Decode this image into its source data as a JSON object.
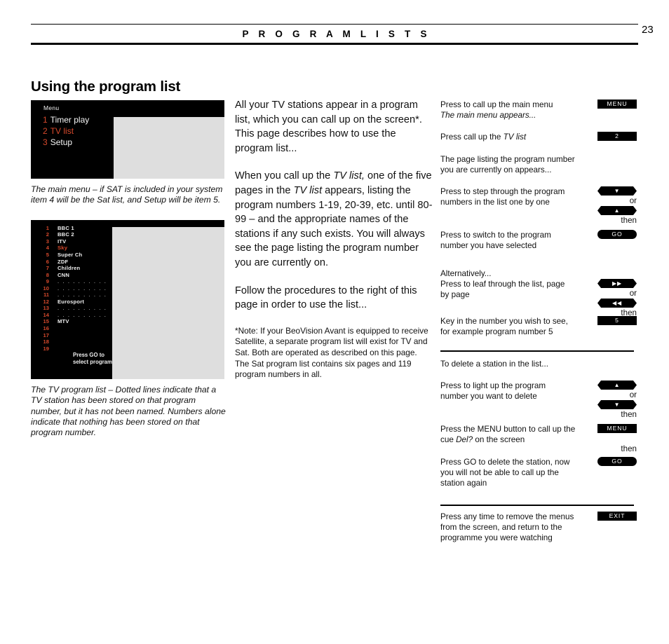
{
  "header": {
    "title": "P R O G R A M   L I S T S",
    "page_number": "23"
  },
  "section": {
    "title": "Using the program list"
  },
  "figures": {
    "menu": {
      "screen_label": "Menu",
      "items": [
        {
          "number": "1",
          "label": "Timer play",
          "highlighted": false
        },
        {
          "number": "2",
          "label": "TV list",
          "highlighted": true
        },
        {
          "number": "3",
          "label": "Setup",
          "highlighted": false
        }
      ],
      "caption": "The main menu – if SAT is included in your system item 4 will be the Sat list, and Setup will be item 5."
    },
    "program_list": {
      "rows": [
        {
          "number": "1",
          "name": "BBC 1",
          "highlighted": false,
          "dots": false
        },
        {
          "number": "2",
          "name": "BBC 2",
          "highlighted": false,
          "dots": false
        },
        {
          "number": "3",
          "name": "ITV",
          "highlighted": false,
          "dots": false
        },
        {
          "number": "4",
          "name": "Sky",
          "highlighted": true,
          "dots": false
        },
        {
          "number": "5",
          "name": "Super Ch",
          "highlighted": false,
          "dots": false
        },
        {
          "number": "6",
          "name": "ZDF",
          "highlighted": false,
          "dots": false
        },
        {
          "number": "7",
          "name": "Children",
          "highlighted": false,
          "dots": false
        },
        {
          "number": "8",
          "name": "CNN",
          "highlighted": false,
          "dots": false
        },
        {
          "number": "9",
          "name": ". . . . . . . . . .",
          "highlighted": false,
          "dots": true
        },
        {
          "number": "10",
          "name": ". . . . . . . . . .",
          "highlighted": false,
          "dots": true
        },
        {
          "number": "11",
          "name": ". . . . . . . . . .",
          "highlighted": false,
          "dots": true
        },
        {
          "number": "12",
          "name": "Eurosport",
          "highlighted": false,
          "dots": false
        },
        {
          "number": "13",
          "name": ". . . . . . . . . .",
          "highlighted": false,
          "dots": true
        },
        {
          "number": "14",
          "name": ". . . . . . . . . .",
          "highlighted": false,
          "dots": true
        },
        {
          "number": "15",
          "name": "MTV",
          "highlighted": false,
          "dots": false
        },
        {
          "number": "16",
          "name": "",
          "highlighted": false,
          "dots": false
        },
        {
          "number": "17",
          "name": "",
          "highlighted": false,
          "dots": false
        },
        {
          "number": "18",
          "name": "",
          "highlighted": false,
          "dots": false
        },
        {
          "number": "19",
          "name": "",
          "highlighted": false,
          "dots": false
        }
      ],
      "footer_line1": "Press GO to",
      "footer_line2": "select program",
      "caption": "The TV program list  –  Dotted lines indicate that a TV station has been stored on that program number, but it has not been named. Numbers alone indicate that nothing has been stored on that program number."
    }
  },
  "main": {
    "paragraph_1": "All your TV stations appear in a program list, which you can call up on the screen*. This page describes how to use the program list...",
    "paragraph_2_pre": "When you call up the ",
    "paragraph_2_italic_1": "TV list,",
    "paragraph_2_mid": " one of the five pages in the ",
    "paragraph_2_italic_2": "TV list",
    "paragraph_2_post": " appears, listing the program numbers 1-19, 20-39, etc. until 80-99 – and the appropriate names of the stations if any such exists. You will always see the page listing the program number you are currently on.",
    "paragraph_3": "Follow the procedures to  the right of this page in order to use the list...",
    "note": "*Note: If your BeoVision Avant is equipped to receive Satellite, a separate program list will exist for TV and Sat. Both are operated as described on this page. The Sat program list contains six pages and 119 program numbers in all."
  },
  "instructions": {
    "connector_or": "or",
    "connector_then": "then",
    "steps": [
      {
        "id": "call-main-menu",
        "text_line1": "Press to call up the main menu",
        "text_line2_italic": "The main menu appears...",
        "badge": {
          "label": "MENU",
          "shape": "rect",
          "icon": "menu-button"
        }
      },
      {
        "id": "call-tv-list",
        "text_pre": "Press call up the ",
        "text_italic": "TV list",
        "badge": {
          "label": "2",
          "shape": "rect",
          "icon": "number-2-button"
        }
      },
      {
        "id": "page-listing-info",
        "text_line1": "The page listing the program number",
        "text_line2": "you are currently on appears..."
      },
      {
        "id": "step-through-programs",
        "text_line1": "Press to step through the program",
        "text_line2": "numbers in the list one by one",
        "badge_primary": {
          "label": "▼",
          "shape": "hex",
          "icon": "arrow-down-button"
        },
        "badge_secondary": {
          "label": "▲",
          "shape": "hex",
          "icon": "arrow-up-button"
        }
      },
      {
        "id": "switch-to-program",
        "text_line1": "Press to switch to the program",
        "text_line2": "number you have selected",
        "badge": {
          "label": "GO",
          "shape": "pill",
          "icon": "go-button"
        }
      },
      {
        "id": "leaf-through-list",
        "text_line0": "Alternatively...",
        "text_line1": "Press to leaf through the list, page",
        "text_line2": "by page",
        "badge_primary": {
          "label": "▶▶",
          "shape": "hex",
          "icon": "fast-forward-button"
        },
        "badge_secondary": {
          "label": "◀◀",
          "shape": "hex",
          "icon": "rewind-button"
        }
      },
      {
        "id": "key-in-number",
        "text_line1": "Key in the number you wish to see,",
        "text_line2": "for example program number 5",
        "badge": {
          "label": "5",
          "shape": "rect",
          "icon": "number-5-button"
        }
      },
      {
        "id": "delete-heading",
        "text_line1": "To delete a station in the list..."
      },
      {
        "id": "light-up-program",
        "text_line1": "Press to light up the program",
        "text_line2": "number you want to delete",
        "badge_primary": {
          "label": "▲",
          "shape": "hex",
          "icon": "arrow-up-button"
        },
        "badge_secondary": {
          "label": "▼",
          "shape": "hex",
          "icon": "arrow-down-button"
        }
      },
      {
        "id": "press-menu-del",
        "text_pre": "Press the MENU button to call up the cue ",
        "text_italic": "Del?",
        "text_post": " on the screen",
        "badge": {
          "label": "MENU",
          "shape": "rect",
          "icon": "menu-button"
        }
      },
      {
        "id": "press-go-delete",
        "text_line1": "Press GO to delete the station, now",
        "text_line2": "you will not be able to call up the",
        "text_line3": "station again",
        "badge": {
          "label": "GO",
          "shape": "pill",
          "icon": "go-button"
        }
      },
      {
        "id": "exit-menus",
        "text_line1": "Press any time to remove the menus",
        "text_line2": "from the screen, and return to the",
        "text_line3": "programme you were watching",
        "badge": {
          "label": "EXIT",
          "shape": "rect",
          "icon": "exit-button"
        }
      }
    ]
  },
  "colors": {
    "accent_red": "#d6492c",
    "screen_black": "#000000",
    "screen_gray": "#dedede"
  }
}
